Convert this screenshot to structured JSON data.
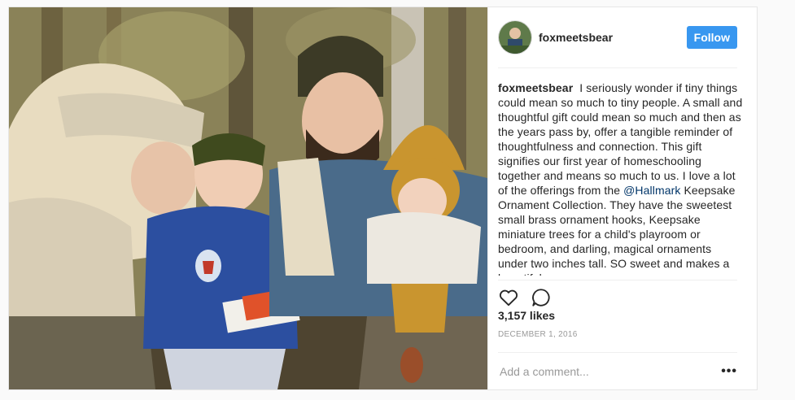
{
  "post": {
    "username": "foxmeetsbear",
    "follow_label": "Follow",
    "caption_username": "foxmeetsbear",
    "caption_text_1": "I seriously wonder if tiny things could mean so much to tiny people. A small and thoughtful gift could mean so much and then as the years pass by, offer a tangible reminder of thoughtfulness and connection. This gift signifies our first year of homeschooling together and means so much to us. I love a lot of the offerings from the",
    "mention": "@Hallmark",
    "caption_text_2": "Keepsake Ornament Collection. They have the sweetest small brass ornament hooks, Keepsake miniature trees for a child's playroom or bedroom, and darling, magical ornaments under two inches tall. SO sweet and makes a beautiful",
    "likes": "3,157 likes",
    "date": "DECEMBER 1, 2016",
    "comment_placeholder": "Add a comment...",
    "more_label": "•••",
    "icons": {
      "like": "heart-icon",
      "comment": "comment-bubble-icon",
      "more": "more-options-icon"
    },
    "colors": {
      "follow_button": "#3897f0",
      "mention": "#003569"
    }
  }
}
